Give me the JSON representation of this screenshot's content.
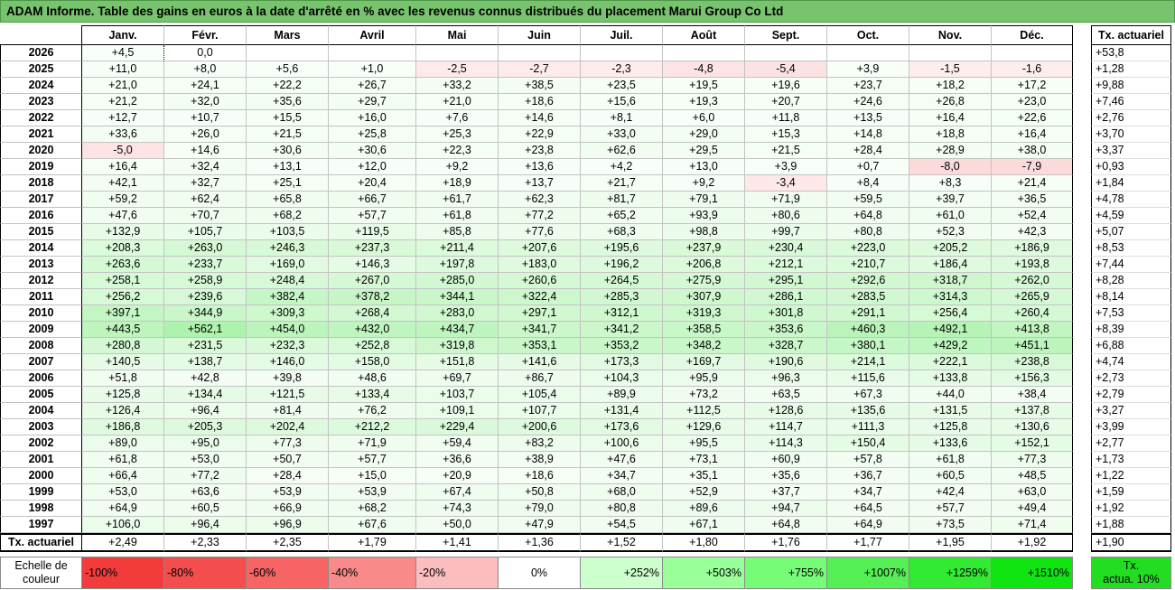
{
  "chart_data": {
    "type": "heatmap",
    "title": "ADAM Informe. Table des gains en euros à la date d'arrêté en % avec les revenus connus distribués du placement Marui Group Co Ltd",
    "columns": [
      "Janv.",
      "Févr.",
      "Mars",
      "Avril",
      "Mai",
      "Juin",
      "Juil.",
      "Août",
      "Sept.",
      "Oct.",
      "Nov.",
      "Déc."
    ],
    "rate_header": "Tx. actuariel",
    "rows": [
      {
        "label": "2026",
        "values": [
          "+4,5",
          "0,0",
          null,
          null,
          null,
          null,
          null,
          null,
          null,
          null,
          null,
          null
        ],
        "rate": "+53,8"
      },
      {
        "label": "2025",
        "values": [
          "+11,0",
          "+8,0",
          "+5,6",
          "+1,0",
          "-2,5",
          "-2,7",
          "-2,3",
          "-4,8",
          "-5,4",
          "+3,9",
          "-1,5",
          "-1,6"
        ],
        "rate": "+1,28"
      },
      {
        "label": "2024",
        "values": [
          "+21,0",
          "+24,1",
          "+22,2",
          "+26,7",
          "+33,2",
          "+38,5",
          "+23,5",
          "+19,5",
          "+19,6",
          "+23,7",
          "+18,2",
          "+17,2"
        ],
        "rate": "+9,88"
      },
      {
        "label": "2023",
        "values": [
          "+21,2",
          "+32,0",
          "+35,6",
          "+29,7",
          "+21,0",
          "+18,6",
          "+15,6",
          "+19,3",
          "+20,7",
          "+24,6",
          "+26,8",
          "+23,0"
        ],
        "rate": "+7,46"
      },
      {
        "label": "2022",
        "values": [
          "+12,7",
          "+10,7",
          "+15,5",
          "+16,0",
          "+7,6",
          "+14,6",
          "+8,1",
          "+6,0",
          "+11,8",
          "+13,5",
          "+16,4",
          "+22,6"
        ],
        "rate": "+2,76"
      },
      {
        "label": "2021",
        "values": [
          "+33,6",
          "+26,0",
          "+21,5",
          "+25,8",
          "+25,3",
          "+22,9",
          "+33,0",
          "+29,0",
          "+15,3",
          "+14,8",
          "+18,8",
          "+16,4"
        ],
        "rate": "+3,70"
      },
      {
        "label": "2020",
        "values": [
          "-5,0",
          "+14,6",
          "+30,6",
          "+30,6",
          "+22,3",
          "+23,8",
          "+62,6",
          "+29,5",
          "+21,5",
          "+28,4",
          "+28,9",
          "+38,0"
        ],
        "rate": "+3,37"
      },
      {
        "label": "2019",
        "values": [
          "+16,4",
          "+32,4",
          "+13,1",
          "+12,0",
          "+9,2",
          "+13,6",
          "+4,2",
          "+13,0",
          "+3,9",
          "+0,7",
          "-8,0",
          "-7,9"
        ],
        "rate": "+0,93"
      },
      {
        "label": "2018",
        "values": [
          "+42,1",
          "+32,7",
          "+25,1",
          "+20,4",
          "+18,9",
          "+13,7",
          "+21,7",
          "+9,2",
          "-3,4",
          "+8,4",
          "+8,3",
          "+21,4"
        ],
        "rate": "+1,84"
      },
      {
        "label": "2017",
        "values": [
          "+59,2",
          "+62,4",
          "+65,8",
          "+66,7",
          "+61,7",
          "+62,3",
          "+81,7",
          "+79,1",
          "+71,9",
          "+59,5",
          "+39,7",
          "+36,5"
        ],
        "rate": "+4,78"
      },
      {
        "label": "2016",
        "values": [
          "+47,6",
          "+70,7",
          "+68,2",
          "+57,7",
          "+61,8",
          "+77,2",
          "+65,2",
          "+93,9",
          "+80,6",
          "+64,8",
          "+61,0",
          "+52,4"
        ],
        "rate": "+4,59"
      },
      {
        "label": "2015",
        "values": [
          "+132,9",
          "+105,7",
          "+103,5",
          "+119,5",
          "+85,8",
          "+77,6",
          "+68,3",
          "+98,8",
          "+99,7",
          "+80,8",
          "+52,3",
          "+42,3"
        ],
        "rate": "+5,07"
      },
      {
        "label": "2014",
        "values": [
          "+208,3",
          "+263,0",
          "+246,3",
          "+237,3",
          "+211,4",
          "+207,6",
          "+195,6",
          "+237,9",
          "+230,4",
          "+223,0",
          "+205,2",
          "+186,9"
        ],
        "rate": "+8,53"
      },
      {
        "label": "2013",
        "values": [
          "+263,6",
          "+233,7",
          "+169,0",
          "+146,3",
          "+197,8",
          "+183,0",
          "+196,2",
          "+206,8",
          "+212,1",
          "+210,7",
          "+186,4",
          "+193,8"
        ],
        "rate": "+7,44"
      },
      {
        "label": "2012",
        "values": [
          "+258,1",
          "+258,9",
          "+248,4",
          "+267,0",
          "+285,0",
          "+260,6",
          "+264,5",
          "+275,9",
          "+295,1",
          "+292,6",
          "+318,7",
          "+262,0"
        ],
        "rate": "+8,28"
      },
      {
        "label": "2011",
        "values": [
          "+256,2",
          "+239,6",
          "+382,4",
          "+378,2",
          "+344,1",
          "+322,4",
          "+285,3",
          "+307,9",
          "+286,1",
          "+283,5",
          "+314,3",
          "+265,9"
        ],
        "rate": "+8,14"
      },
      {
        "label": "2010",
        "values": [
          "+397,1",
          "+344,9",
          "+309,3",
          "+268,4",
          "+283,0",
          "+297,1",
          "+312,1",
          "+319,3",
          "+301,8",
          "+291,1",
          "+256,4",
          "+260,4"
        ],
        "rate": "+7,53"
      },
      {
        "label": "2009",
        "values": [
          "+443,5",
          "+562,1",
          "+454,0",
          "+432,0",
          "+434,7",
          "+341,7",
          "+341,2",
          "+358,5",
          "+353,6",
          "+460,3",
          "+492,1",
          "+413,8"
        ],
        "rate": "+8,39"
      },
      {
        "label": "2008",
        "values": [
          "+280,8",
          "+231,5",
          "+232,3",
          "+252,8",
          "+319,8",
          "+353,1",
          "+353,2",
          "+348,2",
          "+328,7",
          "+380,1",
          "+429,2",
          "+451,1"
        ],
        "rate": "+6,88"
      },
      {
        "label": "2007",
        "values": [
          "+140,5",
          "+138,7",
          "+146,0",
          "+158,0",
          "+151,8",
          "+141,6",
          "+173,3",
          "+169,7",
          "+190,6",
          "+214,1",
          "+222,1",
          "+238,8"
        ],
        "rate": "+4,74"
      },
      {
        "label": "2006",
        "values": [
          "+51,8",
          "+42,8",
          "+39,8",
          "+48,6",
          "+69,7",
          "+86,7",
          "+104,3",
          "+95,9",
          "+96,3",
          "+115,6",
          "+133,8",
          "+156,3"
        ],
        "rate": "+2,73"
      },
      {
        "label": "2005",
        "values": [
          "+125,8",
          "+134,4",
          "+121,5",
          "+133,4",
          "+103,7",
          "+105,4",
          "+89,9",
          "+73,2",
          "+63,5",
          "+67,3",
          "+44,0",
          "+38,4"
        ],
        "rate": "+2,79"
      },
      {
        "label": "2004",
        "values": [
          "+126,4",
          "+96,4",
          "+81,4",
          "+76,2",
          "+109,1",
          "+107,7",
          "+131,4",
          "+112,5",
          "+128,6",
          "+135,6",
          "+131,5",
          "+137,8"
        ],
        "rate": "+3,27"
      },
      {
        "label": "2003",
        "values": [
          "+186,8",
          "+205,3",
          "+202,4",
          "+212,2",
          "+229,4",
          "+200,6",
          "+173,6",
          "+129,6",
          "+114,7",
          "+111,3",
          "+125,8",
          "+130,6"
        ],
        "rate": "+3,99"
      },
      {
        "label": "2002",
        "values": [
          "+89,0",
          "+95,0",
          "+77,3",
          "+71,9",
          "+59,4",
          "+83,2",
          "+100,6",
          "+95,5",
          "+114,3",
          "+150,4",
          "+133,6",
          "+152,1"
        ],
        "rate": "+2,77"
      },
      {
        "label": "2001",
        "values": [
          "+61,8",
          "+53,0",
          "+50,7",
          "+57,7",
          "+36,6",
          "+38,9",
          "+47,6",
          "+73,1",
          "+60,9",
          "+57,8",
          "+61,8",
          "+77,3"
        ],
        "rate": "+1,73"
      },
      {
        "label": "2000",
        "values": [
          "+66,4",
          "+77,2",
          "+28,4",
          "+15,0",
          "+20,9",
          "+18,6",
          "+34,7",
          "+35,1",
          "+35,6",
          "+36,7",
          "+60,5",
          "+48,5"
        ],
        "rate": "+1,22"
      },
      {
        "label": "1999",
        "values": [
          "+53,0",
          "+63,6",
          "+53,9",
          "+53,9",
          "+67,4",
          "+50,8",
          "+68,0",
          "+52,9",
          "+37,7",
          "+34,7",
          "+42,4",
          "+63,0"
        ],
        "rate": "+1,59"
      },
      {
        "label": "1998",
        "values": [
          "+64,9",
          "+60,5",
          "+66,9",
          "+68,2",
          "+74,3",
          "+79,0",
          "+80,8",
          "+89,6",
          "+94,7",
          "+64,5",
          "+57,7",
          "+49,4"
        ],
        "rate": "+1,92"
      },
      {
        "label": "1997",
        "values": [
          "+106,0",
          "+96,4",
          "+96,9",
          "+67,6",
          "+50,0",
          "+47,9",
          "+54,5",
          "+67,1",
          "+64,8",
          "+64,9",
          "+73,5",
          "+71,4"
        ],
        "rate": "+1,88"
      }
    ],
    "summary": {
      "label": "Tx. actuariel",
      "values": [
        "+2,49",
        "+2,33",
        "+2,35",
        "+1,79",
        "+1,41",
        "+1,36",
        "+1,52",
        "+1,80",
        "+1,76",
        "+1,77",
        "+1,95",
        "+1,92"
      ],
      "rate": "+1,90"
    },
    "legend": {
      "label": "Echelle de\ncouleur",
      "placement": "bottom",
      "steps": [
        {
          "label": "-100%",
          "color": "#f23c3c"
        },
        {
          "label": "-80%",
          "color": "#f44d4d"
        },
        {
          "label": "-60%",
          "color": "#f66464"
        },
        {
          "label": "-40%",
          "color": "#f88a8a"
        },
        {
          "label": "-20%",
          "color": "#fbbdbd"
        },
        {
          "label": "0%",
          "color": "#ffffff"
        },
        {
          "label": "+252%",
          "color": "#ccffcc"
        },
        {
          "label": "+503%",
          "color": "#99ff99"
        },
        {
          "label": "+755%",
          "color": "#77fc77"
        },
        {
          "label": "+1007%",
          "color": "#55ef55"
        },
        {
          "label": "+1259%",
          "color": "#33ea33"
        },
        {
          "label": "+1510%",
          "color": "#11e511"
        }
      ],
      "rate": {
        "label": "Tx.\nactua. 10%",
        "color": "#22dd22"
      }
    },
    "grid": true
  },
  "colors": {
    "title_bg": "#78c46e",
    "positive_fill": "#22dd22",
    "negative_fill": "#f33d3d"
  }
}
